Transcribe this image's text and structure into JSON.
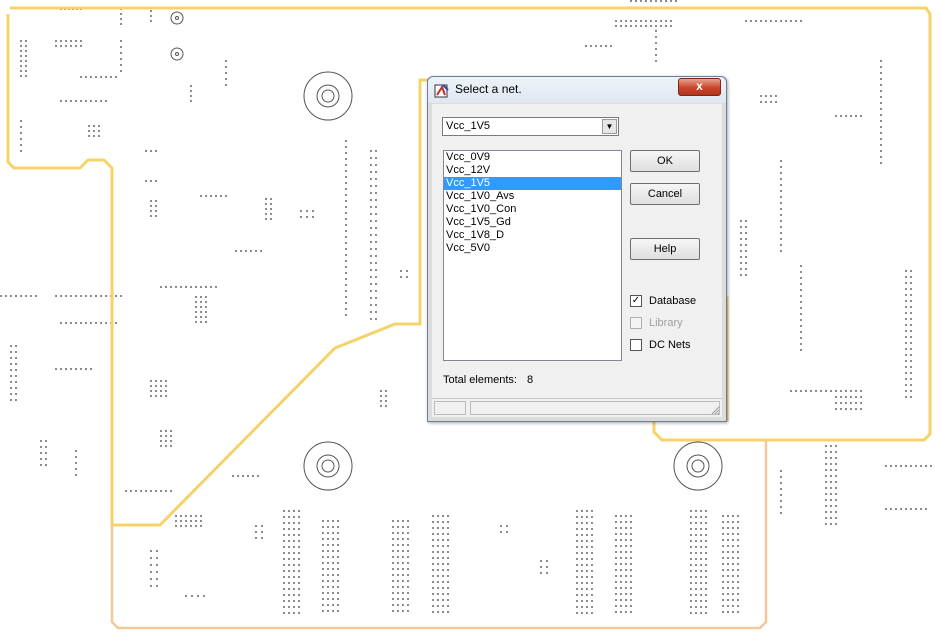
{
  "colors": {
    "board_outline": "#f5d36a",
    "board_outline_lower": "#f1c89a",
    "selection": "#3399ff",
    "close_button": "#c9452b"
  },
  "dialog": {
    "title": "Select a net.",
    "close_glyph": "x",
    "combo": {
      "value": "Vcc_1V5",
      "arrow": "▼"
    },
    "nets": [
      "Vcc_0V9",
      "Vcc_12V",
      "Vcc_1V5",
      "Vcc_1V0_Avs",
      "Vcc_1V0_Con",
      "Vcc_1V5_Gd",
      "Vcc_1V8_D",
      "Vcc_5V0"
    ],
    "selected_net": "Vcc_1V5",
    "buttons": {
      "ok": "OK",
      "cancel": "Cancel",
      "help": "Help"
    },
    "checkboxes": {
      "database": {
        "label": "Database",
        "checked": true,
        "enabled": true
      },
      "library": {
        "label": "Library",
        "checked": false,
        "enabled": false
      },
      "dc_nets": {
        "label": "DC Nets",
        "checked": false,
        "enabled": true
      }
    },
    "total_label": "Total elements:",
    "total_count": "8"
  },
  "icons": [
    "app-icon",
    "close-icon",
    "dropdown-arrow-icon",
    "size-grip-icon",
    "mounting-hole-icon"
  ]
}
